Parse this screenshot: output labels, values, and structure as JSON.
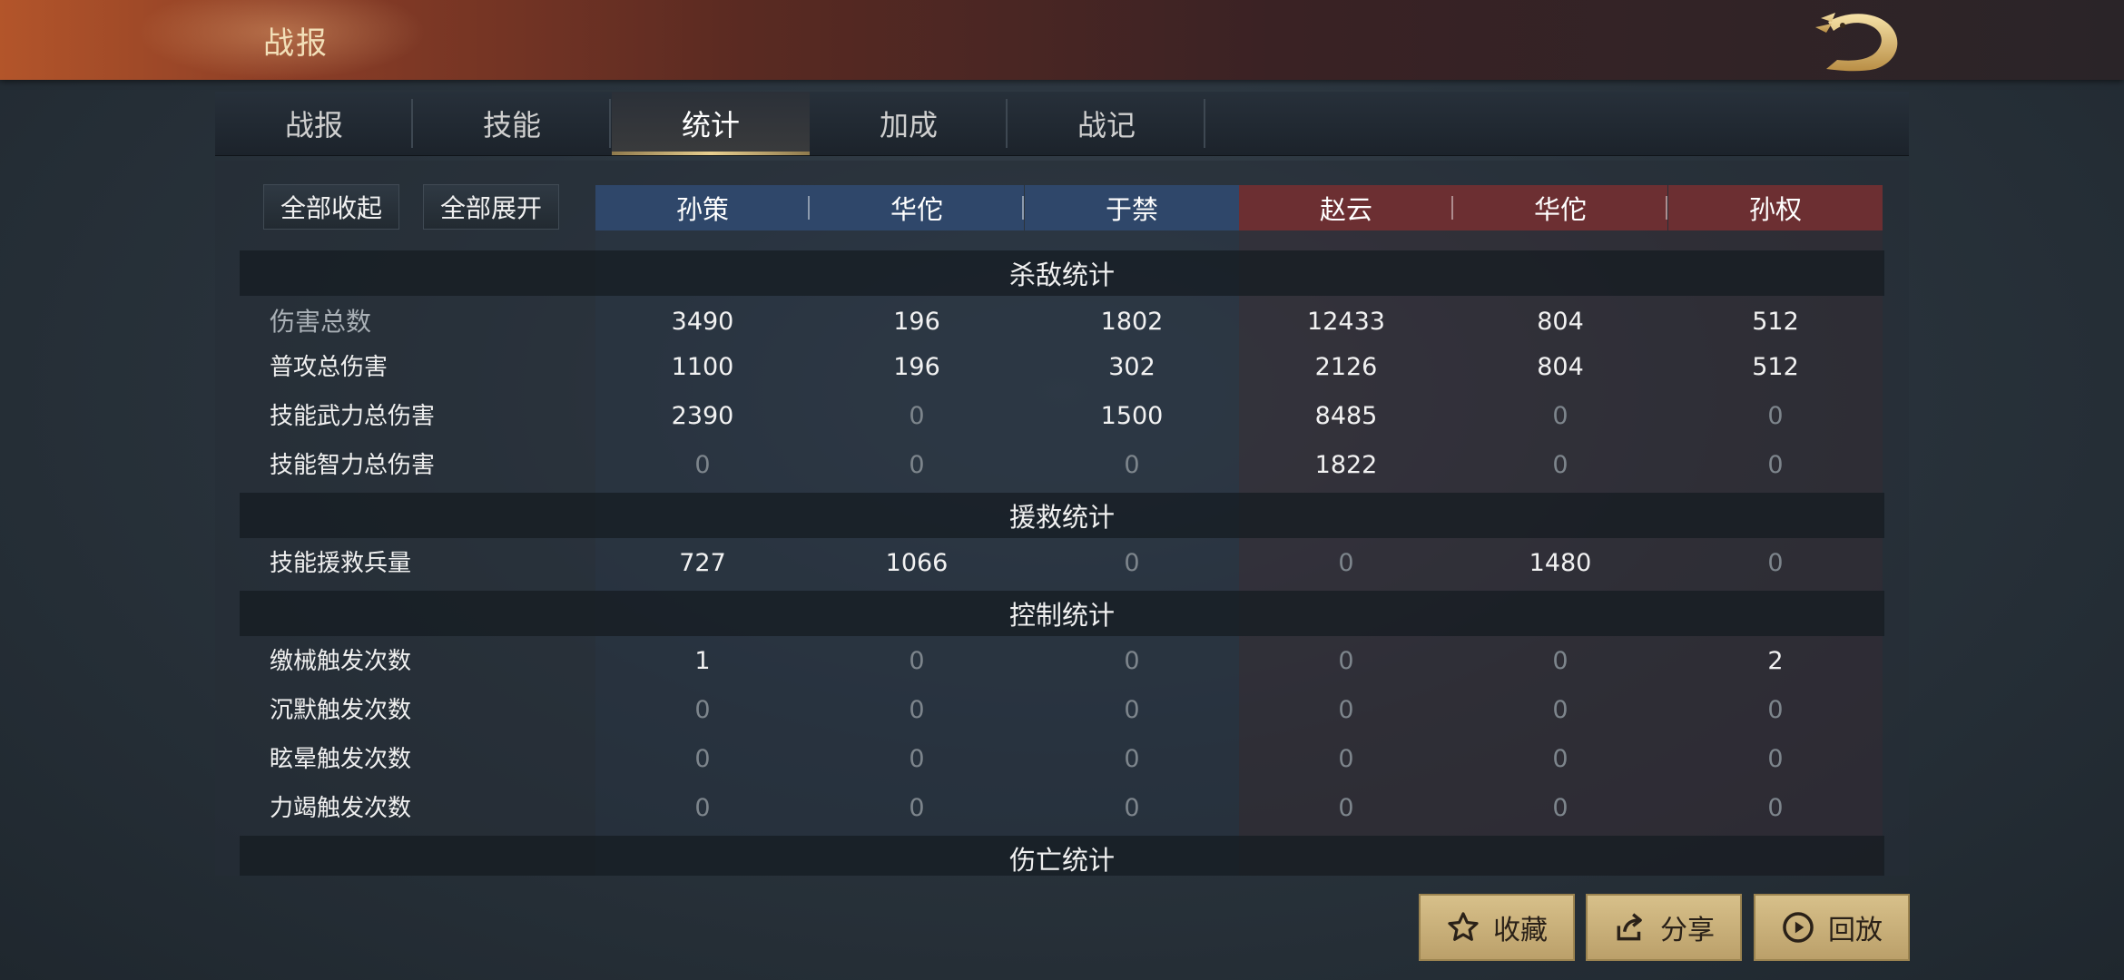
{
  "header": {
    "title": "战报"
  },
  "tabs": [
    "战报",
    "技能",
    "统计",
    "加成",
    "战记"
  ],
  "active_tab_index": 2,
  "controls": {
    "collapse_all": "全部收起",
    "expand_all": "全部展开"
  },
  "players": {
    "blue": [
      "孙策",
      "华佗",
      "于禁"
    ],
    "red": [
      "赵云",
      "华佗",
      "孙权"
    ]
  },
  "sections": {
    "kill": {
      "title": "杀敌统计",
      "rows": [
        {
          "label": "伤害总数",
          "values": [
            "3490",
            "196",
            "1802",
            "12433",
            "804",
            "512"
          ]
        },
        {
          "label": "普攻总伤害",
          "values": [
            "1100",
            "196",
            "302",
            "2126",
            "804",
            "512"
          ]
        },
        {
          "label": "技能武力总伤害",
          "values": [
            "2390",
            "0",
            "1500",
            "8485",
            "0",
            "0"
          ]
        },
        {
          "label": "技能智力总伤害",
          "values": [
            "0",
            "0",
            "0",
            "1822",
            "0",
            "0"
          ]
        }
      ]
    },
    "rescue": {
      "title": "援救统计",
      "rows": [
        {
          "label": "技能援救兵量",
          "values": [
            "727",
            "1066",
            "0",
            "0",
            "1480",
            "0"
          ]
        }
      ]
    },
    "control": {
      "title": "控制统计",
      "rows": [
        {
          "label": "缴械触发次数",
          "values": [
            "1",
            "0",
            "0",
            "0",
            "0",
            "2"
          ]
        },
        {
          "label": "沉默触发次数",
          "values": [
            "0",
            "0",
            "0",
            "0",
            "0",
            "0"
          ]
        },
        {
          "label": "眩晕触发次数",
          "values": [
            "0",
            "0",
            "0",
            "0",
            "0",
            "0"
          ]
        },
        {
          "label": "力竭触发次数",
          "values": [
            "0",
            "0",
            "0",
            "0",
            "0",
            "0"
          ]
        }
      ]
    },
    "casualty": {
      "title": "伤亡统计"
    }
  },
  "actions": {
    "favorite": "收藏",
    "share": "分享",
    "replay": "回放"
  },
  "icons": {
    "logo": "dragon-logo-icon",
    "favorite": "star-icon",
    "share": "share-icon",
    "replay": "play-circle-icon"
  },
  "colors": {
    "blue_team": "#2f476a",
    "red_team": "#6c2f32",
    "gold": "#d7c08a"
  }
}
